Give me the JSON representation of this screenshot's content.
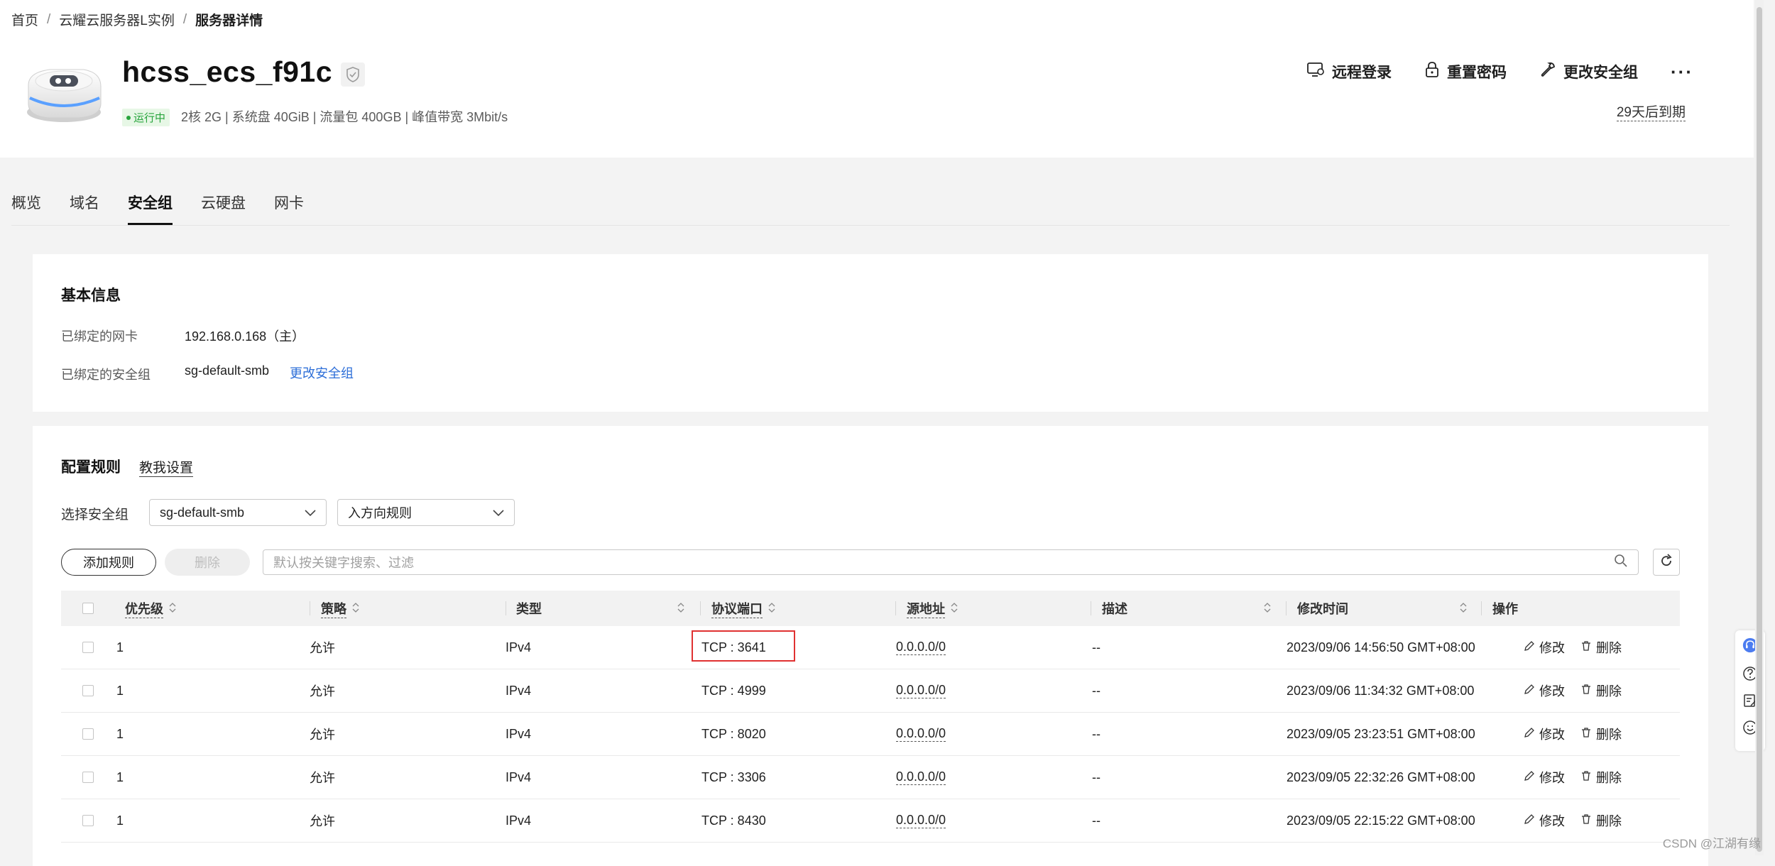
{
  "breadcrumb": {
    "items": [
      "首页",
      "云耀云服务器L实例",
      "服务器详情"
    ]
  },
  "header": {
    "title": "hcss_ecs_f91c",
    "status": "运行中",
    "specs": "2核  2G | 系统盘 40GiB | 流量包 400GB | 峰值带宽 3Mbit/s",
    "expire": "29天后到期",
    "actions": {
      "remote_login": "远程登录",
      "reset_password": "重置密码",
      "change_sg": "更改安全组",
      "more": "···"
    }
  },
  "tabs": [
    "概览",
    "域名",
    "安全组",
    "云硬盘",
    "网卡"
  ],
  "active_tab": "安全组",
  "basic_info": {
    "title": "基本信息",
    "nic_label": "已绑定的网卡",
    "nic_value": "192.168.0.168（主）",
    "sg_label": "已绑定的安全组",
    "sg_value": "sg-default-smb",
    "sg_change_link": "更改安全组"
  },
  "rules": {
    "title": "配置规则",
    "help_link": "教我设置",
    "select_label": "选择安全组",
    "select_sg_value": "sg-default-smb",
    "select_direction_value": "入方向规则",
    "add_button": "添加规则",
    "delete_button": "删除",
    "search_placeholder": "默认按关键字搜索、过滤"
  },
  "table": {
    "headers": {
      "priority": "优先级",
      "policy": "策略",
      "type": "类型",
      "port": "协议端口",
      "source": "源地址",
      "desc": "描述",
      "modified": "修改时间",
      "ops": "操作"
    },
    "rows": [
      {
        "priority": "1",
        "policy": "允许",
        "type": "IPv4",
        "port": "TCP : 3641",
        "source": "0.0.0.0/0",
        "desc": "--",
        "modified": "2023/09/06 14:56:50 GMT+08:00",
        "edit": "修改",
        "del": "删除"
      },
      {
        "priority": "1",
        "policy": "允许",
        "type": "IPv4",
        "port": "TCP : 4999",
        "source": "0.0.0.0/0",
        "desc": "--",
        "modified": "2023/09/06 11:34:32 GMT+08:00",
        "edit": "修改",
        "del": "删除"
      },
      {
        "priority": "1",
        "policy": "允许",
        "type": "IPv4",
        "port": "TCP : 8020",
        "source": "0.0.0.0/0",
        "desc": "--",
        "modified": "2023/09/05 23:23:51 GMT+08:00",
        "edit": "修改",
        "del": "删除"
      },
      {
        "priority": "1",
        "policy": "允许",
        "type": "IPv4",
        "port": "TCP : 3306",
        "source": "0.0.0.0/0",
        "desc": "--",
        "modified": "2023/09/05 22:32:26 GMT+08:00",
        "edit": "修改",
        "del": "删除"
      },
      {
        "priority": "1",
        "policy": "允许",
        "type": "IPv4",
        "port": "TCP : 8430",
        "source": "0.0.0.0/0",
        "desc": "--",
        "modified": "2023/09/05 22:15:22 GMT+08:00",
        "edit": "修改",
        "del": "删除"
      }
    ]
  },
  "watermark": "CSDN @江湖有缘",
  "colors": {
    "accent_link": "#2e6fd8",
    "status_green": "#27a43c",
    "highlight_red": "#e03131",
    "float_active": "#4c7cf0"
  }
}
